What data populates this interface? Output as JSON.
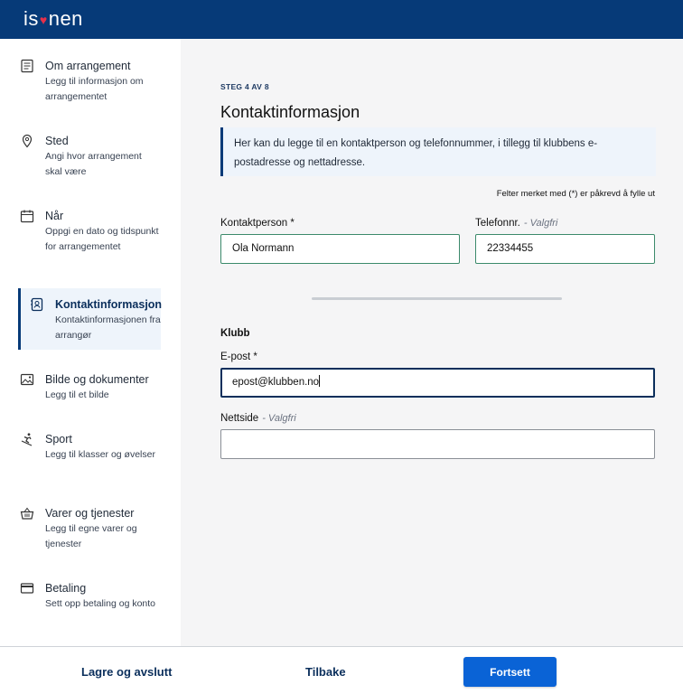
{
  "header": {
    "logo_left": "is",
    "logo_right": "nen",
    "logo_heart": "♥"
  },
  "sidebar": {
    "items": [
      {
        "title": "Om arrangement",
        "desc": "Legg til informasjon om arrangementet",
        "icon": "document-icon"
      },
      {
        "title": "Sted",
        "desc": "Angi hvor arrangement skal være",
        "icon": "location-pin-icon"
      },
      {
        "title": "Når",
        "desc": "Oppgi en dato og tidspunkt for arrangementet",
        "icon": "calendar-icon"
      },
      {
        "title": "Kontaktinformasjon",
        "desc": "Kontaktinformasjonen fra arrangør",
        "icon": "contact-book-icon"
      },
      {
        "title": "Bilde og dokumenter",
        "desc": "Legg til et bilde",
        "icon": "image-icon"
      },
      {
        "title": "Sport",
        "desc": "Legg til klasser og øvelser",
        "icon": "skier-icon"
      },
      {
        "title": "Varer og tjenester",
        "desc": "Legg til egne varer og tjenester",
        "icon": "basket-icon"
      },
      {
        "title": "Betaling",
        "desc": "Sett opp betaling og konto",
        "icon": "credit-card-icon"
      }
    ],
    "active_index": 3
  },
  "main": {
    "step": "STEG 4 AV 8",
    "title": "Kontaktinformasjon",
    "info": "Her kan du legge til en kontaktperson og telefonnummer, i tillegg til klubbens e-postadresse og nettadresse.",
    "required_note": "Felter merket med (*) er påkrevd å fylle ut",
    "contact_label": "Kontaktperson *",
    "contact_value": "Ola Normann",
    "phone_label": "Telefonnr.",
    "phone_optional": "- Valgfri",
    "phone_value": "22334455",
    "club_title": "Klubb",
    "email_label": "E-post *",
    "email_value": "epost@klubben.no",
    "website_label": "Nettside",
    "website_optional": "- Valgfri",
    "website_value": ""
  },
  "footer": {
    "save_exit": "Lagre og avslutt",
    "back": "Tilbake",
    "continue": "Fortsett"
  },
  "colors": {
    "brand": "#063a78",
    "primary_button": "#0a63d6",
    "valid_border": "#3b8a6b",
    "logo_heart": "#e5304a"
  }
}
